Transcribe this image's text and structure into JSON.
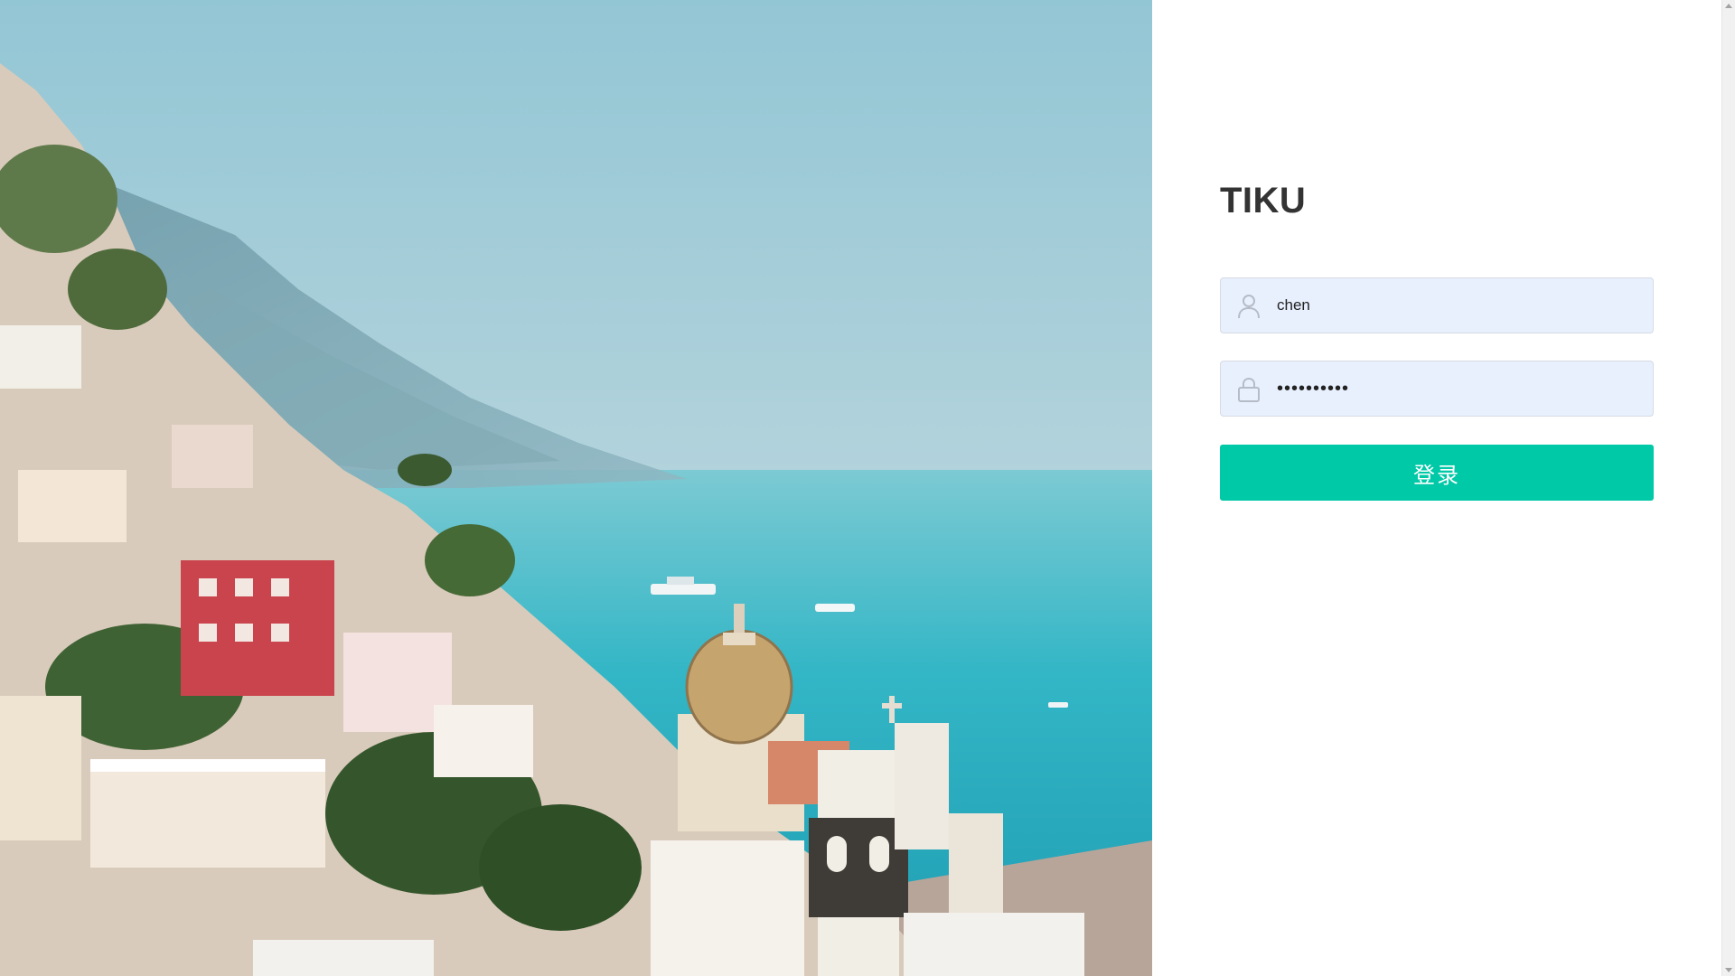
{
  "app": {
    "title": "TIKU"
  },
  "login": {
    "username": {
      "value": "chen",
      "icon": "user-icon"
    },
    "password": {
      "value": "••••••••••",
      "icon": "lock-icon"
    },
    "submit_label": "登录"
  },
  "colors": {
    "primary_button": "#00c9a7",
    "input_background": "#e8f0fe",
    "title_text": "#333333"
  },
  "hero": {
    "description_icon": "coastal-town-photo"
  }
}
